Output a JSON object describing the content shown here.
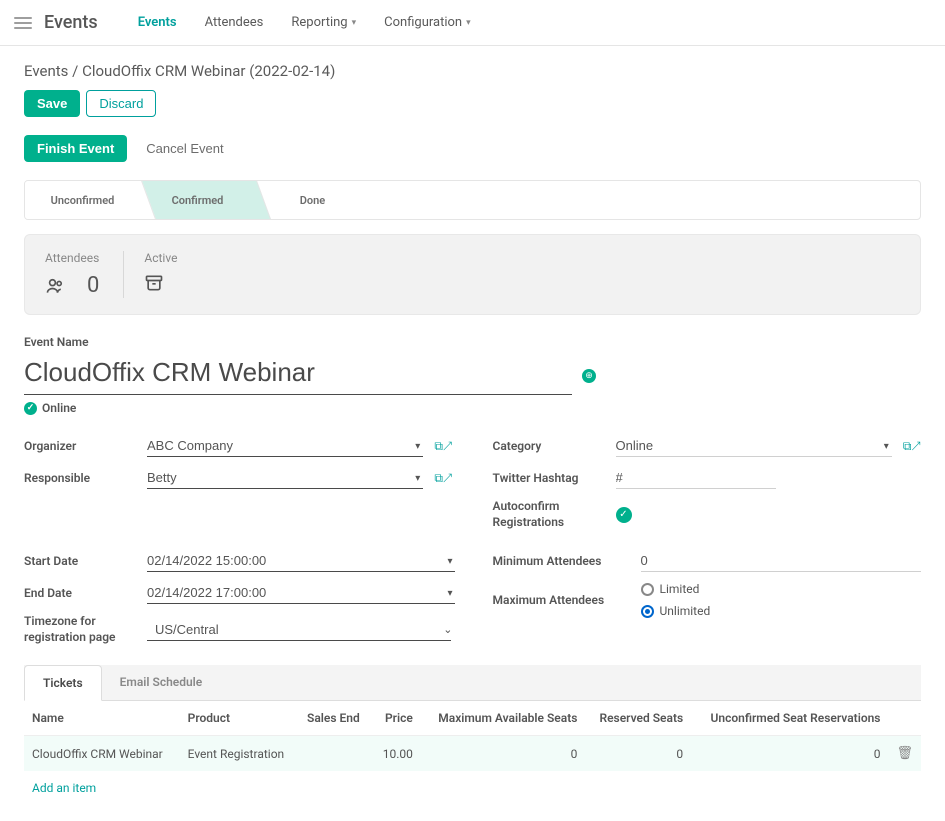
{
  "brand": "Events",
  "nav": {
    "events": "Events",
    "attendees": "Attendees",
    "reporting": "Reporting",
    "configuration": "Configuration"
  },
  "crumb_root": "Events",
  "crumb_sep": "/",
  "crumb_page": "CloudOffix CRM Webinar (2022-02-14)",
  "buttons": {
    "save": "Save",
    "discard": "Discard",
    "finish": "Finish Event",
    "cancel": "Cancel Event",
    "add_item": "Add an item"
  },
  "stages": {
    "unconfirmed": "Unconfirmed",
    "confirmed": "Confirmed",
    "done": "Done"
  },
  "stats": {
    "attendees_label": "Attendees",
    "attendees_count": "0",
    "active_label": "Active"
  },
  "labels": {
    "event_name": "Event Name",
    "online": "Online",
    "organizer": "Organizer",
    "responsible": "Responsible",
    "category": "Category",
    "twitter": "Twitter Hashtag",
    "autoconfirm": "Autoconfirm Registrations",
    "start_date": "Start Date",
    "end_date": "End Date",
    "timezone": "Timezone for registration page",
    "min_attendees": "Minimum Attendees",
    "max_attendees": "Maximum Attendees",
    "limited": "Limited",
    "unlimited": "Unlimited"
  },
  "values": {
    "event_name": "CloudOffix CRM Webinar",
    "organizer": "ABC Company",
    "responsible": "Betty",
    "category": "Online",
    "twitter": "#",
    "start_date": "02/14/2022 15:00:00",
    "end_date": "02/14/2022 17:00:00",
    "timezone": "US/Central",
    "min_attendees": "0"
  },
  "tabs": {
    "tickets": "Tickets",
    "email": "Email Schedule"
  },
  "table": {
    "headers": {
      "name": "Name",
      "product": "Product",
      "sales_end": "Sales End",
      "price": "Price",
      "max_seats": "Maximum Available Seats",
      "reserved": "Reserved Seats",
      "unconfirmed": "Unconfirmed Seat Reservations"
    },
    "rows": [
      {
        "name": "CloudOffix CRM Webinar",
        "product": "Event Registration",
        "sales_end": "",
        "price": "10.00",
        "max_seats": "0",
        "reserved": "0",
        "unconfirmed": "0"
      }
    ]
  }
}
